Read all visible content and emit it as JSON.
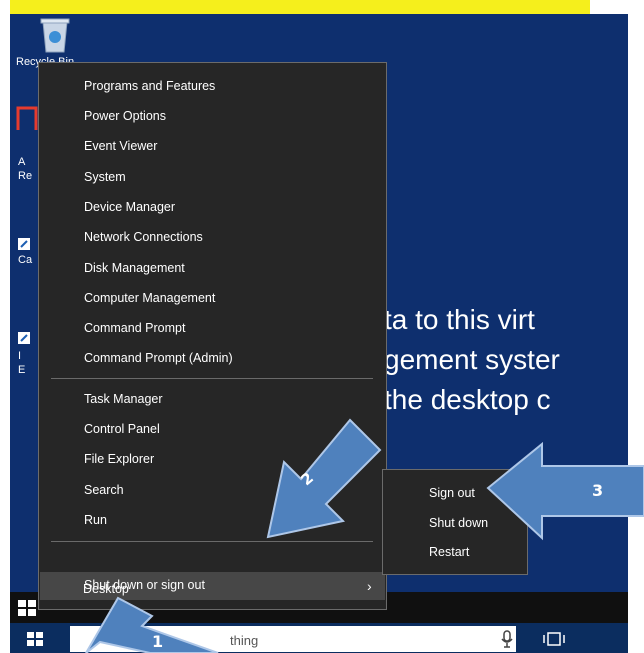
{
  "desktop": {
    "recycle_label": "Recycle Bin",
    "side_labels": [
      "A",
      "Re",
      "Ca",
      "I",
      "E"
    ],
    "bg_lines": [
      "ta to this virt",
      "gement syster",
      "the desktop c"
    ]
  },
  "context_menu": {
    "items": [
      "Programs and Features",
      "Power Options",
      "Event Viewer",
      "System",
      "Device Manager",
      "Network Connections",
      "Disk Management",
      "Computer Management",
      "Command Prompt",
      "Command Prompt (Admin)",
      "Task Manager",
      "Control Panel",
      "File Explorer",
      "Search",
      "Run",
      "Shut down or sign out",
      "Desktop"
    ]
  },
  "submenu": {
    "items": [
      "Sign out",
      "Shut down",
      "Restart"
    ]
  },
  "taskbar": {
    "search_text": "thing"
  },
  "annotations": {
    "step1": "1",
    "step2": "2",
    "step3": "3",
    "arrow_color": "#4f81bd"
  },
  "colors": {
    "desktop_bg": "#0e2f6e",
    "menu_bg": "#262626",
    "menu_highlight": "#474747",
    "top_highlight": "#f5ef1c"
  },
  "icons": [
    "recycle-bin-icon",
    "windows-start-icon",
    "microphone-icon",
    "task-view-icon",
    "chevron-right-icon",
    "arrow-icon"
  ]
}
